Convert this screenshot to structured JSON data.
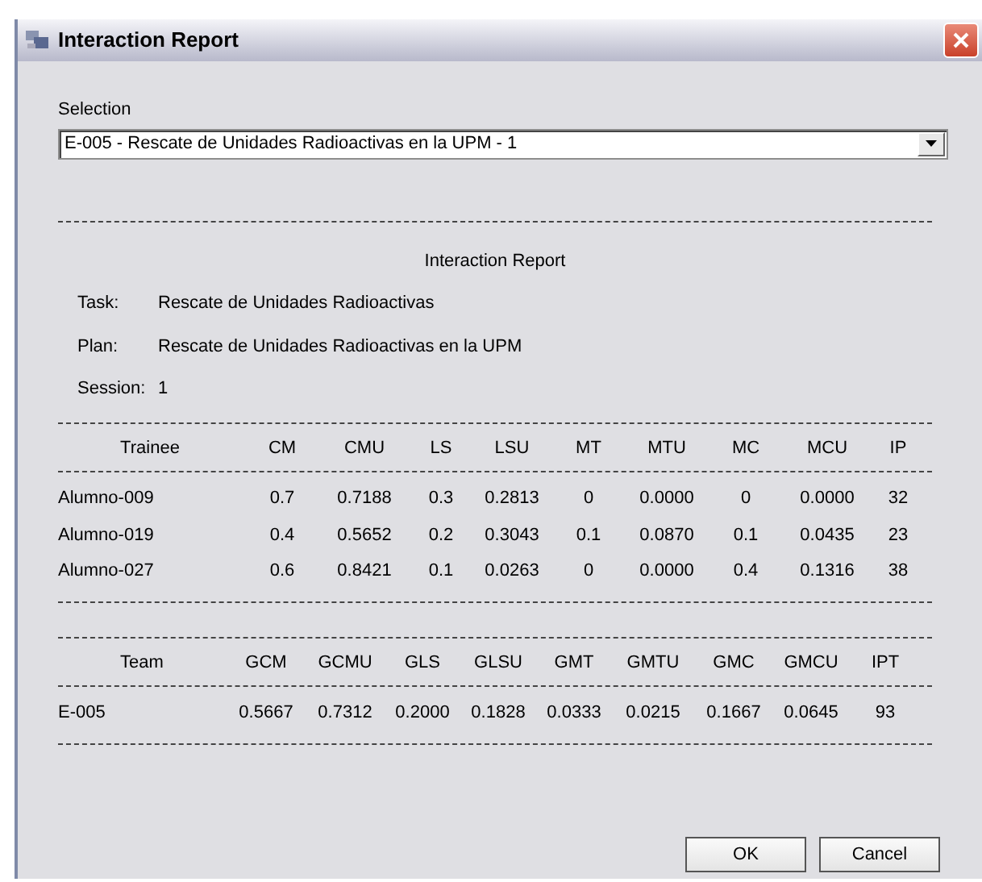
{
  "window": {
    "title": "Interaction Report"
  },
  "selection": {
    "label": "Selection",
    "value": "E-005 - Rescate de Unidades Radioactivas en la UPM - 1"
  },
  "report": {
    "title": "Interaction Report",
    "fields": [
      {
        "label": "Task:",
        "value": "Rescate de Unidades Radioactivas"
      },
      {
        "label": "Plan:",
        "value": "Rescate de Unidades Radioactivas en la UPM"
      },
      {
        "label": "Session:",
        "value": "1"
      }
    ],
    "trainee_table": {
      "columns": [
        "Trainee",
        "CM",
        "CMU",
        "LS",
        "LSU",
        "MT",
        "MTU",
        "MC",
        "MCU",
        "IP"
      ],
      "rows": [
        [
          "Alumno-009",
          "0.7",
          "0.7188",
          "0.3",
          "0.2813",
          "0",
          "0.0000",
          "0",
          "0.0000",
          "32"
        ],
        [
          "Alumno-019",
          "0.4",
          "0.5652",
          "0.2",
          "0.3043",
          "0.1",
          "0.0870",
          "0.1",
          "0.0435",
          "23"
        ],
        [
          "Alumno-027",
          "0.6",
          "0.8421",
          "0.1",
          "0.0263",
          "0",
          "0.0000",
          "0.4",
          "0.1316",
          "38"
        ]
      ]
    },
    "team_table": {
      "columns": [
        "Team",
        "GCM",
        "GCMU",
        "GLS",
        "GLSU",
        "GMT",
        "GMTU",
        "GMC",
        "GMCU",
        "IPT"
      ],
      "rows": [
        [
          "E-005",
          "0.5667",
          "0.7312",
          "0.2000",
          "0.1828",
          "0.0333",
          "0.0215",
          "0.1667",
          "0.0645",
          "93"
        ]
      ]
    }
  },
  "buttons": [
    "OK",
    "Cancel"
  ]
}
